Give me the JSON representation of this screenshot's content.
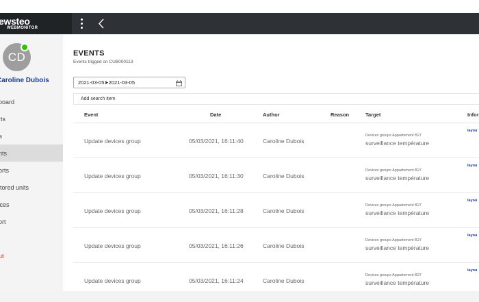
{
  "brand": {
    "name": "ewsteo",
    "subtitle": "WEBMONITOR"
  },
  "user": {
    "initials": "CD",
    "name": "Caroline Dubois"
  },
  "sidebar": {
    "items": [
      {
        "label": "hboard",
        "active": false
      },
      {
        "label": "orts",
        "active": false
      },
      {
        "label": "rts",
        "active": false
      },
      {
        "label": "ents",
        "active": true
      },
      {
        "label": "ports",
        "active": false
      },
      {
        "label": "nitored units",
        "active": false
      },
      {
        "label": "vices",
        "active": false
      },
      {
        "label": "port",
        "active": false
      },
      {
        "label": "rs",
        "active": false
      },
      {
        "label": "out",
        "active": false
      }
    ]
  },
  "page": {
    "title": "EVENTS",
    "subtitle": "Events trigged on CUB000113"
  },
  "filters": {
    "date_range": "2021-03-05➤2021-03-05",
    "search_item": "Add search item"
  },
  "table": {
    "headers": [
      "Event",
      "Date",
      "Author",
      "Reason",
      "Target",
      "Infor"
    ],
    "rows": [
      {
        "event": "Update devices group",
        "date": "05/03/2021, 16:11:40",
        "author": "Caroline Dubois",
        "reason": "",
        "target_group": "Devices groups Appartement B27",
        "target_name": "surveillance température",
        "info": "layou"
      },
      {
        "event": "Update devices group",
        "date": "05/03/2021, 16:11:30",
        "author": "Caroline Dubois",
        "reason": "",
        "target_group": "Devices groups Appartement B27",
        "target_name": "surveillance température",
        "info": "layou"
      },
      {
        "event": "Update devices group",
        "date": "05/03/2021, 16:11:28",
        "author": "Caroline Dubois",
        "reason": "",
        "target_group": "Devices groups Appartement B27",
        "target_name": "surveillance température",
        "info": "layou"
      },
      {
        "event": "Update devices group",
        "date": "05/03/2021, 16:11:26",
        "author": "Caroline Dubois",
        "reason": "",
        "target_group": "Devices groups Appartement B27",
        "target_name": "surveillance température",
        "info": "layou"
      },
      {
        "event": "Update devices group",
        "date": "05/03/2021, 16:11:24",
        "author": "Caroline Dubois",
        "reason": "",
        "target_group": "Devices groups Appartement B27",
        "target_name": "surveillance température",
        "info": "layou"
      }
    ]
  },
  "icons": {
    "menu": "kebab-menu-icon",
    "back": "chevron-left-icon",
    "calendar": "calendar-icon"
  },
  "colors": {
    "topbar": "#2e3236",
    "brand_bg": "#1f2326",
    "user_name": "#1e3c96",
    "logout": "#d42626",
    "status_online": "#2cc400",
    "active_nav": "#dcdcdc"
  }
}
